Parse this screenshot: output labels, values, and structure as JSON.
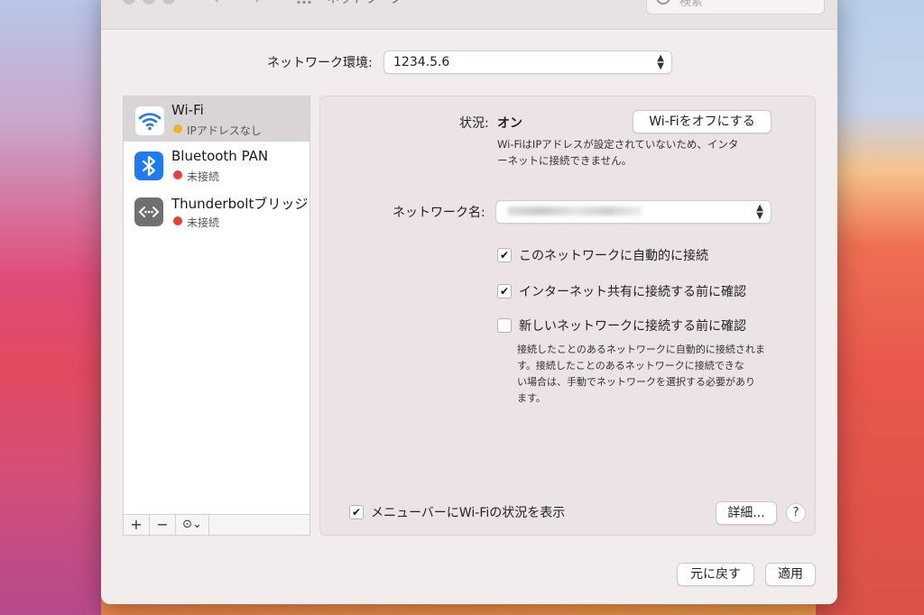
{
  "window": {
    "title": "ネットワーク",
    "search_placeholder": "検索"
  },
  "location": {
    "label": "ネットワーク環境:",
    "value": "1234.5.6"
  },
  "services": [
    {
      "name": "Wi-Fi",
      "status": "IPアドレスなし",
      "status_color": "#f2b12c",
      "icon": "wifi-icon"
    },
    {
      "name": "Bluetooth PAN",
      "status": "未接続",
      "status_color": "#e5413a",
      "icon": "bluetooth-icon"
    },
    {
      "name": "Thunderboltブリッジ",
      "status": "未接続",
      "status_color": "#e5413a",
      "icon": "thunderbolt-bridge-icon"
    }
  ],
  "sidebar_tools": {
    "add": "+",
    "remove": "−",
    "more": "⊙⌄"
  },
  "detail": {
    "status_label": "状況:",
    "status_value": "オン",
    "wifi_off_button": "Wi-Fiをオフにする",
    "status_note_line1": "Wi-FiはIPアドレスが設定されていないため、インタ",
    "status_note_line2": "ーネットに接続できません。",
    "network_name_label": "ネットワーク名:",
    "options": [
      {
        "label": "このネットワークに自動的に接続",
        "checked": true
      },
      {
        "label": "インターネット共有に接続する前に確認",
        "checked": true
      },
      {
        "label": "新しいネットワークに接続する前に確認",
        "checked": false
      }
    ],
    "ask_note_line1": "接続したことのあるネットワークに自動的に接続されま",
    "ask_note_line2": "す。接続したことのあるネットワークに接続できな",
    "ask_note_line3": "い場合は、手動でネットワークを選択する必要があり",
    "ask_note_line4": "ます。",
    "menubar_label": "メニューバーにWi-Fiの状況を表示",
    "menubar_checked": true,
    "advanced_button": "詳細...",
    "help_button": "?"
  },
  "footer": {
    "revert_button": "元に戻す",
    "apply_button": "適用"
  }
}
